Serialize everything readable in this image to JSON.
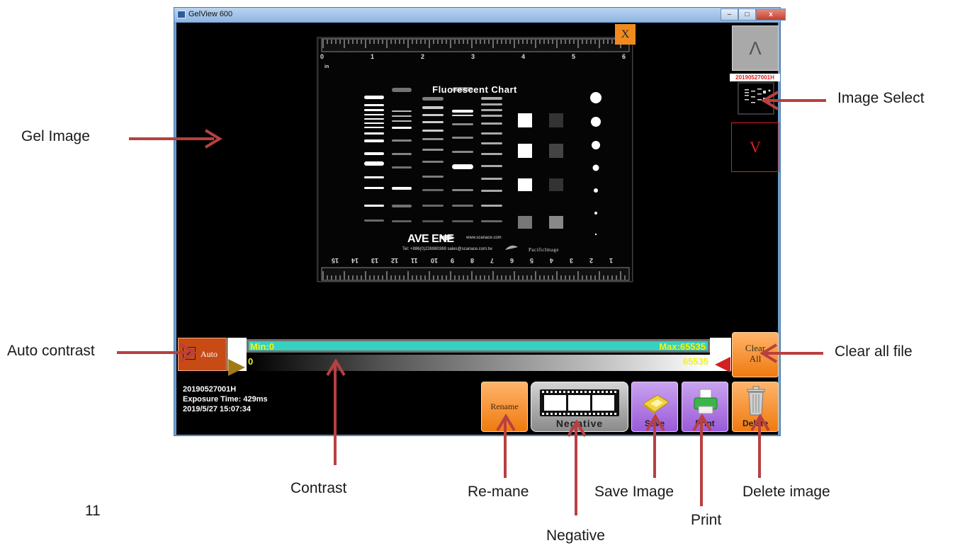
{
  "window": {
    "title": "GelView 600",
    "controls": {
      "minimize": "–",
      "maximize": "□",
      "close": "x"
    }
  },
  "gel_image": {
    "close_label": "X",
    "chart_title": "Fluorescent Chart",
    "ruler_top_unit": "in",
    "ruler_top_numbers": [
      "0",
      "1",
      "2",
      "3",
      "4",
      "5",
      "6"
    ],
    "ruler_bottom_numbers": [
      "15",
      "14",
      "13",
      "12",
      "11",
      "10",
      "9",
      "8",
      "7",
      "6",
      "5",
      "4",
      "3",
      "2",
      "1"
    ],
    "brand": "AVE ENE",
    "brand_url": "www.scanace.com",
    "brand_tel": "Tel: +886(0)226980369  sales@scanace.com.tw",
    "brand_partner": "PacificImage"
  },
  "image_select": {
    "up_label": "Λ",
    "thumbnail_label": "20190527001H",
    "down_label": "V"
  },
  "contrast": {
    "auto_label": "Auto",
    "auto_checked": true,
    "min_label": "Min:0",
    "max_label": "Max:65535",
    "current_min": "0",
    "current_max": "65535"
  },
  "clear_all": {
    "line1": "Clear",
    "line2": "All"
  },
  "info": {
    "filename": "20190527001H",
    "exposure": "Exposure Time: 429ms",
    "datetime": "2019/5/27 15:07:34"
  },
  "buttons": {
    "rename": "Rename",
    "negative": "Negative",
    "save": "Save",
    "print": "Print",
    "delete": "Delete"
  },
  "annotations": {
    "gel_image": "Gel Image",
    "image_select": "Image Select",
    "auto_contrast": "Auto contrast",
    "clear_all_file": "Clear all file",
    "contrast": "Contrast",
    "rename": "Re-mane",
    "negative": "Negative",
    "save_image": "Save Image",
    "print": "Print",
    "delete_image": "Delete image",
    "page_number": "11"
  },
  "colors": {
    "annotation_arrow": "#b84040",
    "orange_button": "#ef7a10",
    "purple_button": "#9a5ad8",
    "range_bar": "#36d1bf",
    "range_text": "#f3f21a"
  }
}
